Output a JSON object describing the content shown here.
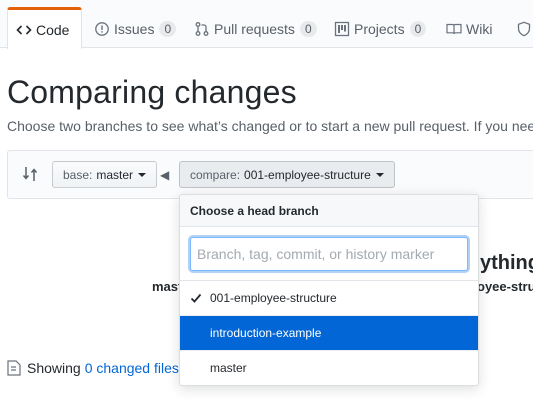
{
  "tabs": [
    {
      "label": "Code",
      "icon": "code-icon",
      "selected": true
    },
    {
      "label": "Issues",
      "icon": "issue-icon",
      "count": "0"
    },
    {
      "label": "Pull requests",
      "icon": "pull-request-icon",
      "count": "0"
    },
    {
      "label": "Projects",
      "icon": "project-icon",
      "count": "0"
    },
    {
      "label": "Wiki",
      "icon": "wiki-icon"
    }
  ],
  "header": {
    "title": "Comparing changes",
    "description": "Choose two branches to see what’s changed or to start a new pull request. If you need"
  },
  "range": {
    "base_label": "base:",
    "base_value": "master",
    "compare_label": "compare:",
    "compare_value": "001-employee-structure"
  },
  "background": {
    "everything_fragment": "ything",
    "master_fragment": "mast",
    "employee_fragment": "oyee-stru",
    "showing_prefix": "Showing",
    "showing_link": "0 changed files"
  },
  "dropdown": {
    "title": "Choose a head branch",
    "placeholder": "Branch, tag, commit, or history marker",
    "items": [
      {
        "label": "001-employee-structure",
        "checked": true
      },
      {
        "label": "introduction-example",
        "highlighted": true
      },
      {
        "label": "master"
      }
    ]
  },
  "colors": {
    "accent": "#0366d6",
    "tab_highlight": "#e36209"
  }
}
